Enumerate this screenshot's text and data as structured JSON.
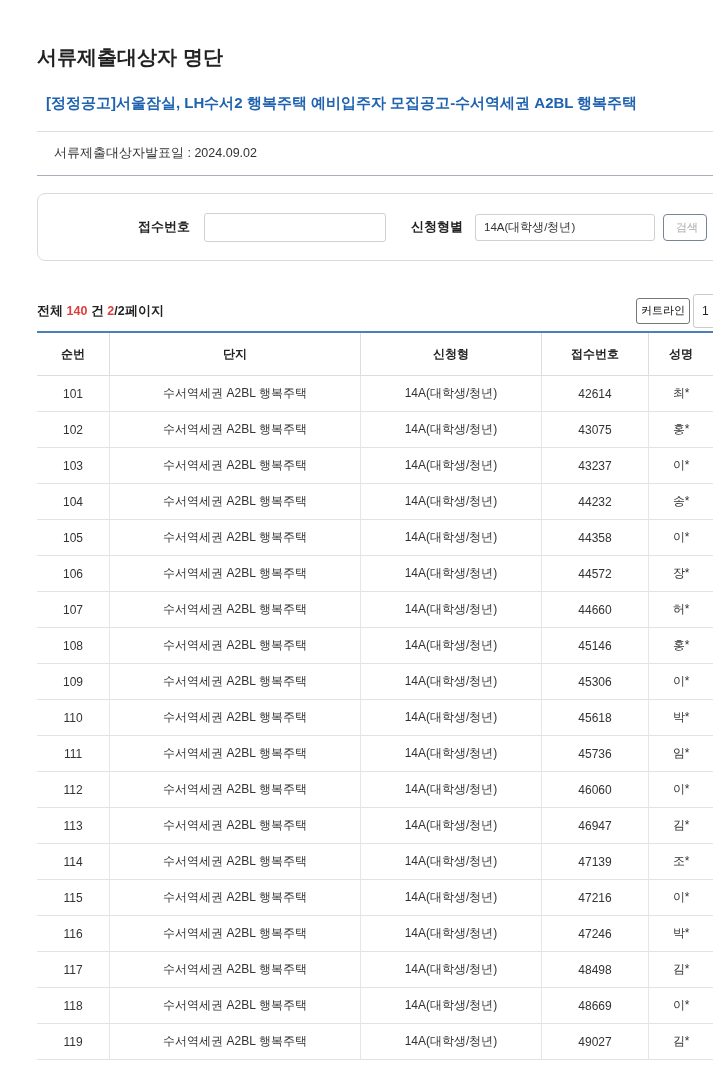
{
  "page_title": "서류제출대상자 명단",
  "notice_link": "[정정공고]서울잠실, LH수서2 행복주택 예비입주자 모집공고-수서역세권 A2BL 행복주택",
  "announce_date": "서류제출대상자발표일 : 2024.09.02",
  "search": {
    "receipt_label": "접수번호",
    "type_label": "신청형별",
    "type_value": "14A(대학생/청년)",
    "button": "검색"
  },
  "summary": {
    "prefix": "전체",
    "total": "140",
    "unit": "건",
    "page_current": "2",
    "page_rest": "/2페이지"
  },
  "cutline_button": "커트라인",
  "page_size": "1",
  "table": {
    "columns": [
      "순번",
      "단지",
      "신청형",
      "접수번호",
      "성명"
    ],
    "rows": [
      [
        "101",
        "수서역세권 A2BL 행복주택",
        "14A(대학생/청년)",
        "42614",
        "최*"
      ],
      [
        "102",
        "수서역세권 A2BL 행복주택",
        "14A(대학생/청년)",
        "43075",
        "홍*"
      ],
      [
        "103",
        "수서역세권 A2BL 행복주택",
        "14A(대학생/청년)",
        "43237",
        "이*"
      ],
      [
        "104",
        "수서역세권 A2BL 행복주택",
        "14A(대학생/청년)",
        "44232",
        "송*"
      ],
      [
        "105",
        "수서역세권 A2BL 행복주택",
        "14A(대학생/청년)",
        "44358",
        "이*"
      ],
      [
        "106",
        "수서역세권 A2BL 행복주택",
        "14A(대학생/청년)",
        "44572",
        "장*"
      ],
      [
        "107",
        "수서역세권 A2BL 행복주택",
        "14A(대학생/청년)",
        "44660",
        "허*"
      ],
      [
        "108",
        "수서역세권 A2BL 행복주택",
        "14A(대학생/청년)",
        "45146",
        "홍*"
      ],
      [
        "109",
        "수서역세권 A2BL 행복주택",
        "14A(대학생/청년)",
        "45306",
        "이*"
      ],
      [
        "110",
        "수서역세권 A2BL 행복주택",
        "14A(대학생/청년)",
        "45618",
        "박*"
      ],
      [
        "111",
        "수서역세권 A2BL 행복주택",
        "14A(대학생/청년)",
        "45736",
        "임*"
      ],
      [
        "112",
        "수서역세권 A2BL 행복주택",
        "14A(대학생/청년)",
        "46060",
        "이*"
      ],
      [
        "113",
        "수서역세권 A2BL 행복주택",
        "14A(대학생/청년)",
        "46947",
        "김*"
      ],
      [
        "114",
        "수서역세권 A2BL 행복주택",
        "14A(대학생/청년)",
        "47139",
        "조*"
      ],
      [
        "115",
        "수서역세권 A2BL 행복주택",
        "14A(대학생/청년)",
        "47216",
        "이*"
      ],
      [
        "116",
        "수서역세권 A2BL 행복주택",
        "14A(대학생/청년)",
        "47246",
        "박*"
      ],
      [
        "117",
        "수서역세권 A2BL 행복주택",
        "14A(대학생/청년)",
        "48498",
        "김*"
      ],
      [
        "118",
        "수서역세권 A2BL 행복주택",
        "14A(대학생/청년)",
        "48669",
        "이*"
      ],
      [
        "119",
        "수서역세권 A2BL 행복주택",
        "14A(대학생/청년)",
        "49027",
        "김*"
      ]
    ]
  }
}
